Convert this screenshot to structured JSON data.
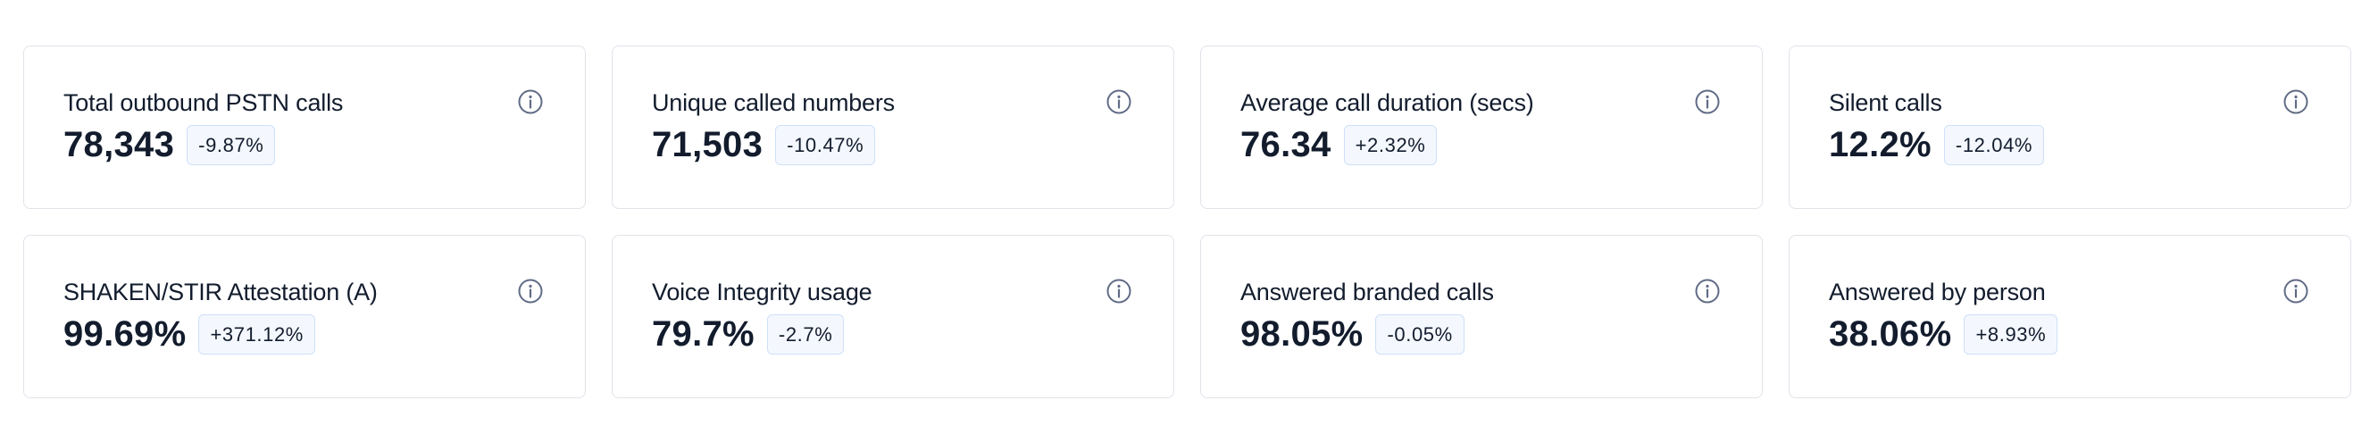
{
  "metrics": [
    {
      "title": "Total outbound PSTN calls",
      "value": "78,343",
      "change": "-9.87%"
    },
    {
      "title": "Unique called numbers",
      "value": "71,503",
      "change": "-10.47%"
    },
    {
      "title": "Average call duration (secs)",
      "value": "76.34",
      "change": "+2.32%"
    },
    {
      "title": "Silent calls",
      "value": "12.2%",
      "change": "-12.04%"
    },
    {
      "title": "SHAKEN/STIR Attestation (A)",
      "value": "99.69%",
      "change": "+371.12%"
    },
    {
      "title": "Voice Integrity usage",
      "value": "79.7%",
      "change": "-2.7%"
    },
    {
      "title": "Answered branded calls",
      "value": "98.05%",
      "change": "-0.05%"
    },
    {
      "title": "Answered by person",
      "value": "38.06%",
      "change": "+8.93%"
    }
  ],
  "icons": {
    "info": "info-icon"
  },
  "colors": {
    "text": "#121c2d",
    "card_border": "#e1e3ea",
    "badge_background": "#f4f8fe",
    "badge_border": "#cfe0f8",
    "icon": "#606b85"
  }
}
